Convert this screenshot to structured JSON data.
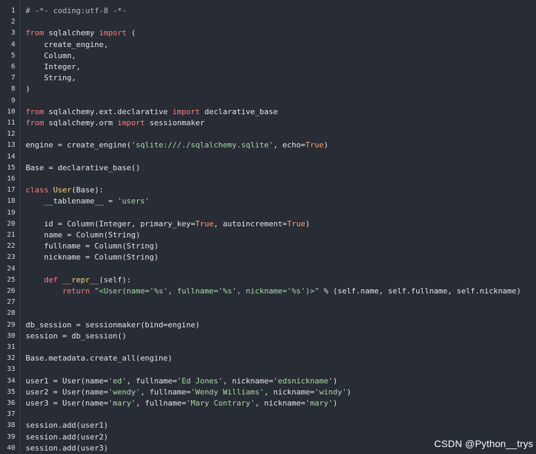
{
  "editor": {
    "lines": [
      {
        "n": "1",
        "t": [
          [
            "cm",
            "# -*- coding:utf-8 -*-"
          ]
        ]
      },
      {
        "n": "2",
        "t": []
      },
      {
        "n": "3",
        "t": [
          [
            "kw",
            "from"
          ],
          [
            "p",
            " sqlalchemy "
          ],
          [
            "kw",
            "import"
          ],
          [
            "p",
            " ("
          ]
        ]
      },
      {
        "n": "4",
        "t": [
          [
            "p",
            "    create_engine,"
          ]
        ]
      },
      {
        "n": "5",
        "t": [
          [
            "p",
            "    Column,"
          ]
        ]
      },
      {
        "n": "6",
        "t": [
          [
            "p",
            "    Integer,"
          ]
        ]
      },
      {
        "n": "7",
        "t": [
          [
            "p",
            "    String,"
          ]
        ]
      },
      {
        "n": "8",
        "t": [
          [
            "p",
            ")"
          ]
        ]
      },
      {
        "n": "9",
        "t": []
      },
      {
        "n": "10",
        "t": [
          [
            "kw",
            "from"
          ],
          [
            "p",
            " sqlalchemy.ext.declarative "
          ],
          [
            "kw",
            "import"
          ],
          [
            "p",
            " declarative_base"
          ]
        ]
      },
      {
        "n": "11",
        "t": [
          [
            "kw",
            "from"
          ],
          [
            "p",
            " sqlalchemy.orm "
          ],
          [
            "kw",
            "import"
          ],
          [
            "p",
            " sessionmaker"
          ]
        ]
      },
      {
        "n": "12",
        "t": []
      },
      {
        "n": "13",
        "t": [
          [
            "p",
            "engine = create_engine("
          ],
          [
            "str",
            "'sqlite:///./sqlalchemy.sqlite'"
          ],
          [
            "p",
            ", echo="
          ],
          [
            "bi",
            "True"
          ],
          [
            "p",
            ")"
          ]
        ]
      },
      {
        "n": "14",
        "t": []
      },
      {
        "n": "15",
        "t": [
          [
            "p",
            "Base = declarative_base()"
          ]
        ]
      },
      {
        "n": "16",
        "t": []
      },
      {
        "n": "17",
        "t": [
          [
            "kw",
            "class"
          ],
          [
            "p",
            " "
          ],
          [
            "cls",
            "User"
          ],
          [
            "p",
            "(Base):"
          ]
        ]
      },
      {
        "n": "18",
        "t": [
          [
            "p",
            "    __tablename__ = "
          ],
          [
            "str",
            "'users'"
          ]
        ]
      },
      {
        "n": "19",
        "t": []
      },
      {
        "n": "20",
        "t": [
          [
            "p",
            "    id = Column(Integer, primary_key="
          ],
          [
            "bi",
            "True"
          ],
          [
            "p",
            ", autoincrement="
          ],
          [
            "bi",
            "True"
          ],
          [
            "p",
            ")"
          ]
        ]
      },
      {
        "n": "21",
        "t": [
          [
            "p",
            "    name = Column(String)"
          ]
        ]
      },
      {
        "n": "22",
        "t": [
          [
            "p",
            "    fullname = Column(String)"
          ]
        ]
      },
      {
        "n": "23",
        "t": [
          [
            "p",
            "    nickname = Column(String)"
          ]
        ]
      },
      {
        "n": "24",
        "t": []
      },
      {
        "n": "25",
        "t": [
          [
            "p",
            "    "
          ],
          [
            "kw",
            "def"
          ],
          [
            "p",
            " "
          ],
          [
            "cls",
            "__repr__"
          ],
          [
            "p",
            "(self):"
          ]
        ]
      },
      {
        "n": "26",
        "t": [
          [
            "p",
            "        "
          ],
          [
            "kw",
            "return"
          ],
          [
            "p",
            " "
          ],
          [
            "str",
            "\"<User(name='%s', fullname='%s', nickname='%s')>\""
          ],
          [
            "p",
            " % (self.name, self.fullname, self.nickname)"
          ]
        ]
      },
      {
        "n": "27",
        "t": []
      },
      {
        "n": "28",
        "t": []
      },
      {
        "n": "29",
        "t": [
          [
            "p",
            "db_session = sessionmaker(bind=engine)"
          ]
        ]
      },
      {
        "n": "30",
        "t": [
          [
            "p",
            "session = db_session()"
          ]
        ]
      },
      {
        "n": "31",
        "t": []
      },
      {
        "n": "32",
        "t": [
          [
            "p",
            "Base.metadata.create_all(engine)"
          ]
        ]
      },
      {
        "n": "33",
        "t": []
      },
      {
        "n": "34",
        "t": [
          [
            "p",
            "user1 = User(name="
          ],
          [
            "str",
            "'ed'"
          ],
          [
            "p",
            ", fullname="
          ],
          [
            "str",
            "'Ed Jones'"
          ],
          [
            "p",
            ", nickname="
          ],
          [
            "str",
            "'edsnickname'"
          ],
          [
            "p",
            ")"
          ]
        ]
      },
      {
        "n": "35",
        "t": [
          [
            "p",
            "user2 = User(name="
          ],
          [
            "str",
            "'wendy'"
          ],
          [
            "p",
            ", fullname="
          ],
          [
            "str",
            "'Wendy Williams'"
          ],
          [
            "p",
            ", nickname="
          ],
          [
            "str",
            "'windy'"
          ],
          [
            "p",
            ")"
          ]
        ]
      },
      {
        "n": "36",
        "t": [
          [
            "p",
            "user3 = User(name="
          ],
          [
            "str",
            "'mary'"
          ],
          [
            "p",
            ", fullname="
          ],
          [
            "str",
            "'Mary Contrary'"
          ],
          [
            "p",
            ", nickname="
          ],
          [
            "str",
            "'mary'"
          ],
          [
            "p",
            ")"
          ]
        ]
      },
      {
        "n": "37",
        "t": []
      },
      {
        "n": "38",
        "t": [
          [
            "p",
            "session.add(user1)"
          ]
        ]
      },
      {
        "n": "39",
        "t": [
          [
            "p",
            "session.add(user2)"
          ]
        ]
      },
      {
        "n": "40",
        "t": [
          [
            "p",
            "session.add(user3)"
          ]
        ]
      }
    ]
  },
  "watermark": "CSDN @Python__trys"
}
